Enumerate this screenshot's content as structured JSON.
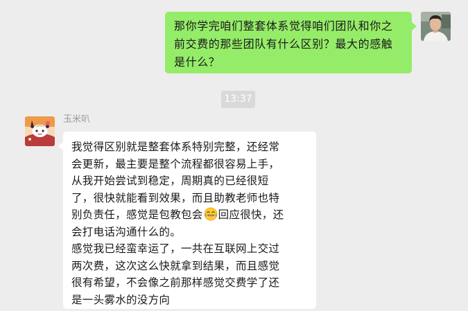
{
  "chat": {
    "outgoing_message": {
      "lines": [
        "那你学完咱们整套体系觉得咱们团队和你之",
        "前交费的那些团队有什么区别？最大的感触",
        "是什么？"
      ]
    },
    "timestamp": "13:37",
    "incoming_message": {
      "sender_name": "玉米叭",
      "lines": [
        "我觉得区别就是整套体系特别完整，还经常",
        "会更新，最主要是整个流程都很容易上手，",
        "从我开始尝试到稳定，周期真的已经很短",
        "了，很快就能看到效果，而且助教老师也特",
        "别负责任，感觉是包教包会",
        "回应很快，还",
        "会打电话沟通什么的。",
        "感觉我已经蛮幸运了，一共在互联网上交过",
        "两次费，这次这么快就拿到结果，而且感觉",
        "很有希望，不会像之前那样感觉交费学了还",
        "是一头雾水的没方向"
      ],
      "emoji": "tears-of-joy-emoji"
    }
  },
  "colors": {
    "background": "#ededed",
    "outgoing_bubble": "#95ec69",
    "incoming_bubble": "#ffffff",
    "timestamp_bg": "#d9d9d9",
    "sender_name": "#9b9b9b"
  }
}
